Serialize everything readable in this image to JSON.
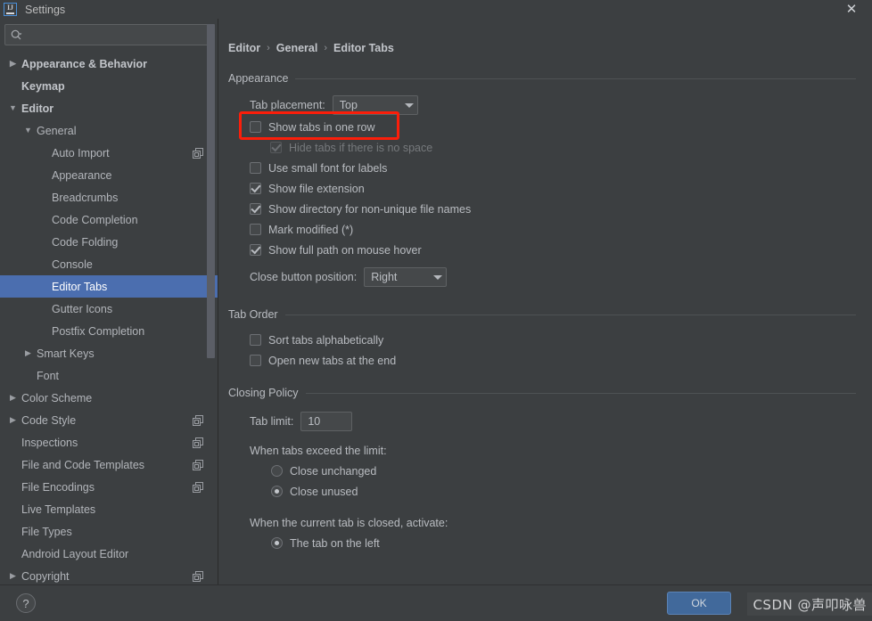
{
  "window": {
    "title": "Settings",
    "app_icon": "intellij-idea-logo",
    "close_icon": "✕"
  },
  "sidebar": {
    "search": {
      "value": "",
      "placeholder": "",
      "icon": "search-icon"
    },
    "items": [
      {
        "label": "Appearance & Behavior",
        "indent": 0,
        "arrow": "collapsed",
        "bold": true,
        "selected": false,
        "scope_icon": false
      },
      {
        "label": "Keymap",
        "indent": 0,
        "arrow": "none",
        "bold": true,
        "selected": false,
        "scope_icon": false
      },
      {
        "label": "Editor",
        "indent": 0,
        "arrow": "expanded",
        "bold": true,
        "selected": false,
        "scope_icon": false
      },
      {
        "label": "General",
        "indent": 1,
        "arrow": "expanded",
        "bold": false,
        "selected": false,
        "scope_icon": false
      },
      {
        "label": "Auto Import",
        "indent": 2,
        "arrow": "none",
        "bold": false,
        "selected": false,
        "scope_icon": true
      },
      {
        "label": "Appearance",
        "indent": 2,
        "arrow": "none",
        "bold": false,
        "selected": false,
        "scope_icon": false
      },
      {
        "label": "Breadcrumbs",
        "indent": 2,
        "arrow": "none",
        "bold": false,
        "selected": false,
        "scope_icon": false
      },
      {
        "label": "Code Completion",
        "indent": 2,
        "arrow": "none",
        "bold": false,
        "selected": false,
        "scope_icon": false
      },
      {
        "label": "Code Folding",
        "indent": 2,
        "arrow": "none",
        "bold": false,
        "selected": false,
        "scope_icon": false
      },
      {
        "label": "Console",
        "indent": 2,
        "arrow": "none",
        "bold": false,
        "selected": false,
        "scope_icon": false
      },
      {
        "label": "Editor Tabs",
        "indent": 2,
        "arrow": "none",
        "bold": false,
        "selected": true,
        "scope_icon": false
      },
      {
        "label": "Gutter Icons",
        "indent": 2,
        "arrow": "none",
        "bold": false,
        "selected": false,
        "scope_icon": false
      },
      {
        "label": "Postfix Completion",
        "indent": 2,
        "arrow": "none",
        "bold": false,
        "selected": false,
        "scope_icon": false
      },
      {
        "label": "Smart Keys",
        "indent": 1,
        "arrow": "collapsed",
        "bold": false,
        "selected": false,
        "scope_icon": false
      },
      {
        "label": "Font",
        "indent": 1,
        "arrow": "none",
        "bold": false,
        "selected": false,
        "scope_icon": false
      },
      {
        "label": "Color Scheme",
        "indent": 0,
        "arrow": "collapsed",
        "bold": false,
        "selected": false,
        "scope_icon": false
      },
      {
        "label": "Code Style",
        "indent": 0,
        "arrow": "collapsed",
        "bold": false,
        "selected": false,
        "scope_icon": true
      },
      {
        "label": "Inspections",
        "indent": 0,
        "arrow": "none",
        "bold": false,
        "selected": false,
        "scope_icon": true
      },
      {
        "label": "File and Code Templates",
        "indent": 0,
        "arrow": "none",
        "bold": false,
        "selected": false,
        "scope_icon": true
      },
      {
        "label": "File Encodings",
        "indent": 0,
        "arrow": "none",
        "bold": false,
        "selected": false,
        "scope_icon": true
      },
      {
        "label": "Live Templates",
        "indent": 0,
        "arrow": "none",
        "bold": false,
        "selected": false,
        "scope_icon": false
      },
      {
        "label": "File Types",
        "indent": 0,
        "arrow": "none",
        "bold": false,
        "selected": false,
        "scope_icon": false
      },
      {
        "label": "Android Layout Editor",
        "indent": 0,
        "arrow": "none",
        "bold": false,
        "selected": false,
        "scope_icon": false
      },
      {
        "label": "Copyright",
        "indent": 0,
        "arrow": "collapsed",
        "bold": false,
        "selected": false,
        "scope_icon": true
      }
    ]
  },
  "breadcrumb": {
    "items": [
      "Editor",
      "General",
      "Editor Tabs"
    ],
    "separator": "›"
  },
  "appearance": {
    "title": "Appearance",
    "tab_placement": {
      "label": "Tab placement:",
      "value": "Top"
    },
    "checkboxes": [
      {
        "label": "Show tabs in one row",
        "checked": false,
        "disabled": false,
        "highlighted": true
      },
      {
        "label": "Hide tabs if there is no space",
        "checked": true,
        "disabled": true,
        "highlighted": false
      },
      {
        "label": "Use small font for labels",
        "checked": false,
        "disabled": false,
        "highlighted": false
      },
      {
        "label": "Show file extension",
        "checked": true,
        "disabled": false,
        "highlighted": false
      },
      {
        "label": "Show directory for non-unique file names",
        "checked": true,
        "disabled": false,
        "highlighted": false
      },
      {
        "label": "Mark modified (*)",
        "checked": false,
        "disabled": false,
        "highlighted": false
      },
      {
        "label": "Show full path on mouse hover",
        "checked": true,
        "disabled": false,
        "highlighted": false
      }
    ],
    "close_button_position": {
      "label": "Close button position:",
      "value": "Right"
    }
  },
  "tab_order": {
    "title": "Tab Order",
    "checkboxes": [
      {
        "label": "Sort tabs alphabetically",
        "checked": false
      },
      {
        "label": "Open new tabs at the end",
        "checked": false
      }
    ]
  },
  "closing_policy": {
    "title": "Closing Policy",
    "tab_limit": {
      "label": "Tab limit:",
      "value": "10"
    },
    "exceed_label": "When tabs exceed the limit:",
    "exceed_options": [
      {
        "label": "Close unchanged",
        "checked": false
      },
      {
        "label": "Close unused",
        "checked": true
      }
    ],
    "closed_label": "When the current tab is closed, activate:",
    "closed_options": [
      {
        "label": "The tab on the left",
        "checked": true
      }
    ]
  },
  "footer": {
    "help_label": "?",
    "ok_label": "OK",
    "watermark": "CSDN @声叩咏兽"
  },
  "colors": {
    "accent_selection": "#4b6eaf",
    "ok_button": "#41699b",
    "highlight_box": "#fb1e0a",
    "panel_bg": "#3c3f41",
    "field_bg": "#45484a"
  }
}
